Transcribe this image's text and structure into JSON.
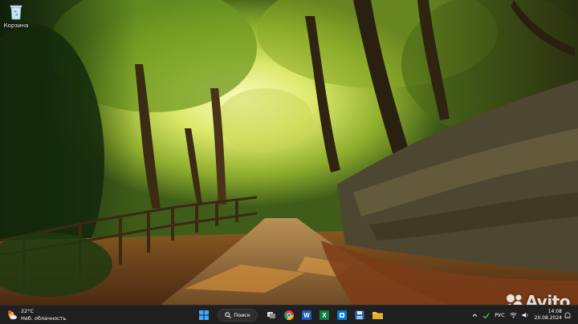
{
  "desktop": {
    "icons": [
      {
        "label": "Корзина",
        "icon": "recycle-bin-icon"
      }
    ],
    "wallpaper": "autumn-forest-path"
  },
  "taskbar": {
    "weather": {
      "temperature": "22°C",
      "condition": "Неб. облачность",
      "icon": "partly-cloudy-icon"
    },
    "search": {
      "label": "Поиск"
    },
    "pinned_apps": [
      {
        "name": "start-button",
        "icon": "windows-logo-icon"
      },
      {
        "name": "task-view",
        "icon": "task-view-icon"
      },
      {
        "name": "chrome",
        "icon": "chrome-icon"
      },
      {
        "name": "word",
        "icon": "word-icon"
      },
      {
        "name": "excel",
        "icon": "excel-icon"
      },
      {
        "name": "outlook",
        "icon": "outlook-icon"
      },
      {
        "name": "save",
        "icon": "floppy-disk-icon"
      },
      {
        "name": "file-explorer",
        "icon": "folder-icon"
      }
    ],
    "tray": {
      "language": "РУС",
      "time": "14:08",
      "date": "20.08.2024"
    }
  },
  "watermark": {
    "text": "Avito"
  },
  "colors": {
    "taskbar_bg": "#202020",
    "word_blue": "#185abd",
    "excel_green": "#107c41",
    "outlook_blue": "#0078d4",
    "folder_yellow": "#f2c14e"
  }
}
